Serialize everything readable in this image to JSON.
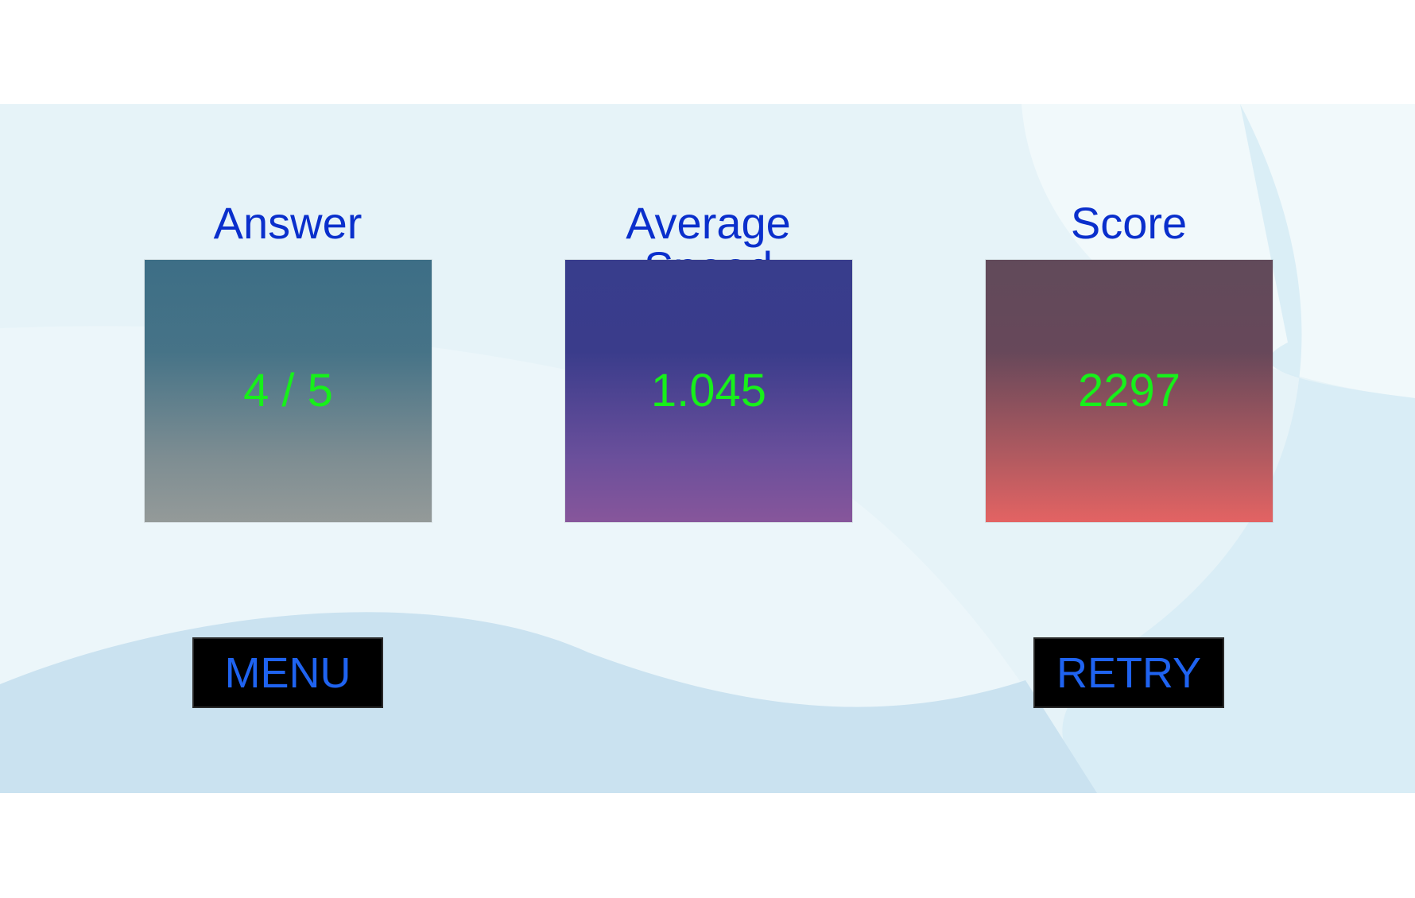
{
  "stats": {
    "answer": {
      "title": "Answer",
      "value": "4 / 5"
    },
    "speed": {
      "title": "Average Speed",
      "value": "1.045"
    },
    "score": {
      "title": "Score",
      "value": "2297"
    }
  },
  "buttons": {
    "menu_label": "MENU",
    "retry_label": "RETRY"
  },
  "colors": {
    "title_text": "#0a2fcc",
    "value_text": "#17f01a",
    "button_text": "#1f63f0",
    "button_bg": "#000000",
    "background": "#e6f3f8"
  }
}
